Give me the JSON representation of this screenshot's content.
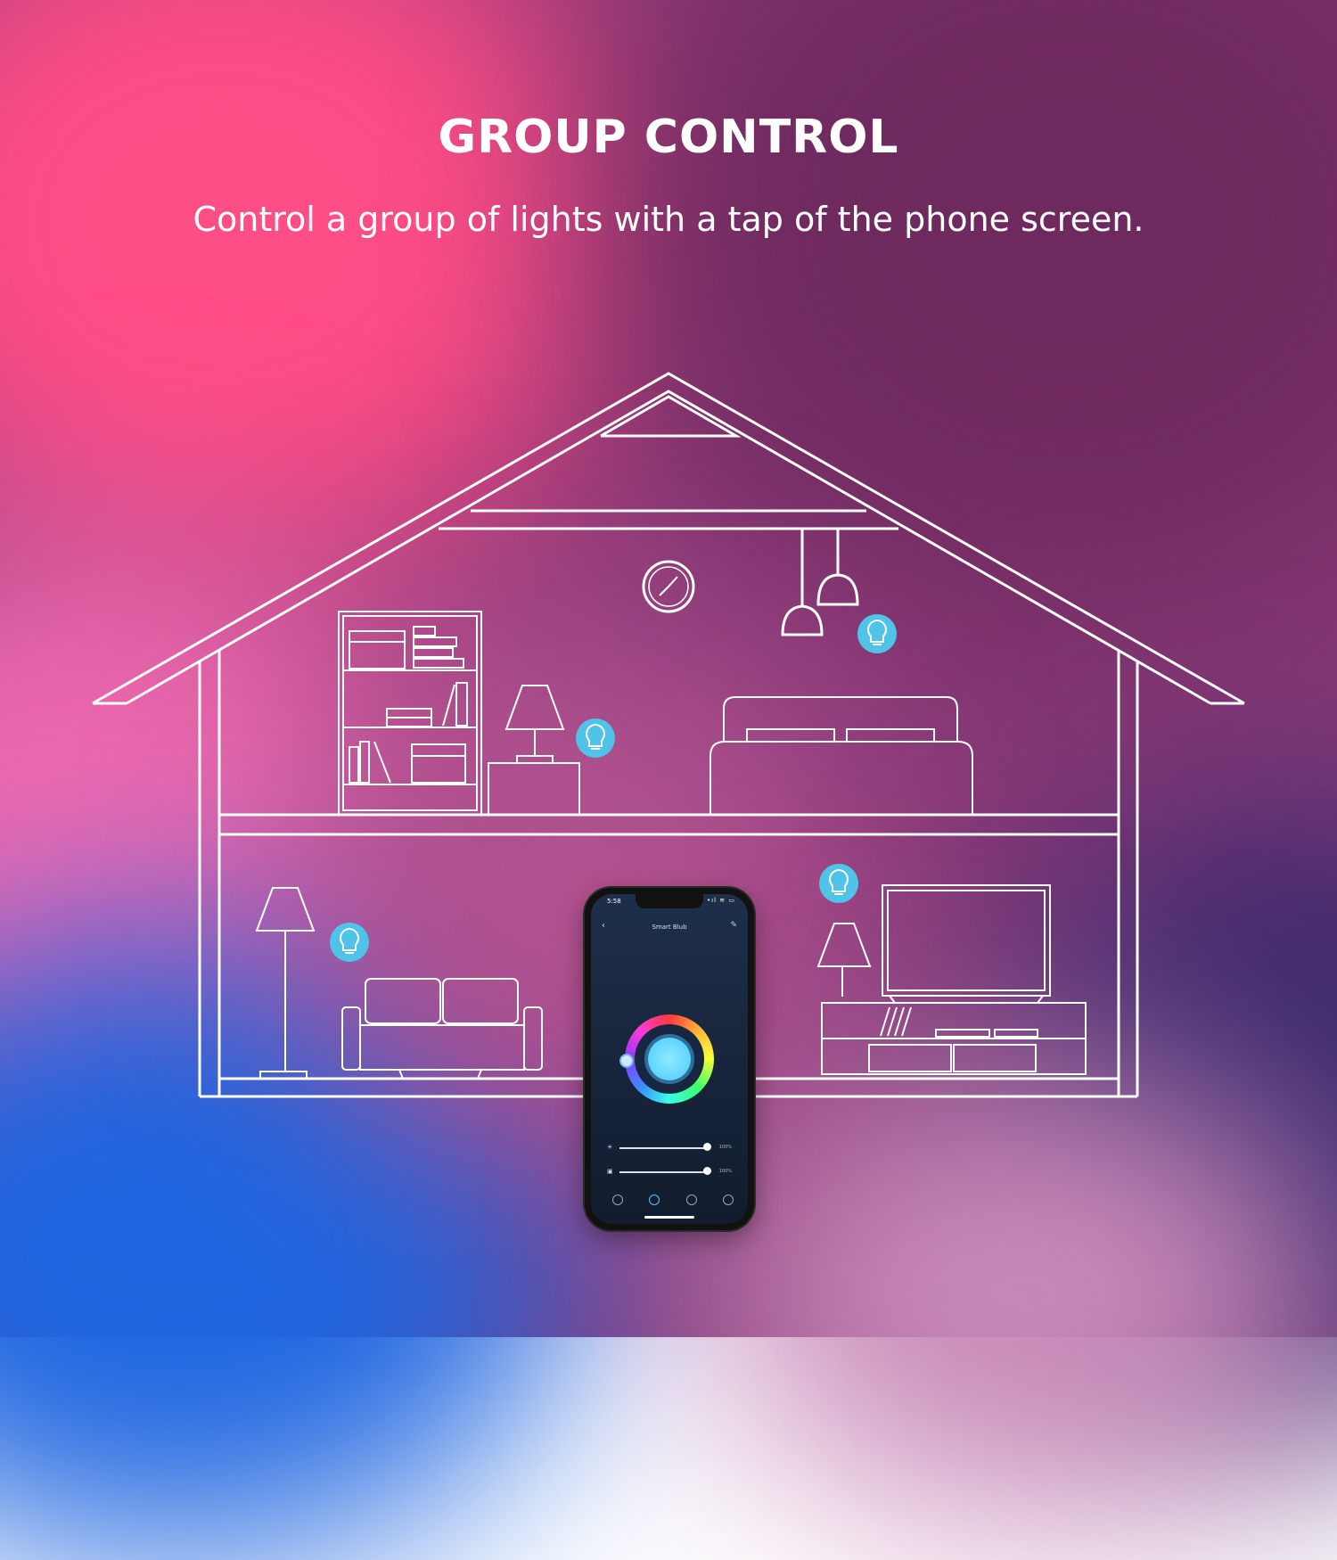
{
  "headline": "GROUP CONTROL",
  "subline": "Control a group of lights with a tap of the phone screen.",
  "colors": {
    "line": "#ffffff",
    "bulb_badge": "#4fc3e8",
    "bg_pink": "#ff4f8a",
    "bg_plum": "#6a2a5a",
    "bg_blue": "#2a6cd8"
  },
  "phone": {
    "time": "5:58",
    "status": "•ıl ≋ ▭",
    "title": "Smart Blub",
    "back_icon": "chevron-left-icon",
    "edit_icon": "pencil-icon",
    "brightness": {
      "icon": "☀",
      "value_pct": 100,
      "label": "100%"
    },
    "temperature": {
      "icon": "▣",
      "value_pct": 100,
      "label": "100%"
    },
    "tabs": [
      "power-icon",
      "color-icon",
      "scene-icon",
      "more-icon"
    ],
    "active_tab": 1
  },
  "bulbs": [
    "bulb-icon",
    "bulb-icon",
    "bulb-icon",
    "bulb-icon"
  ]
}
